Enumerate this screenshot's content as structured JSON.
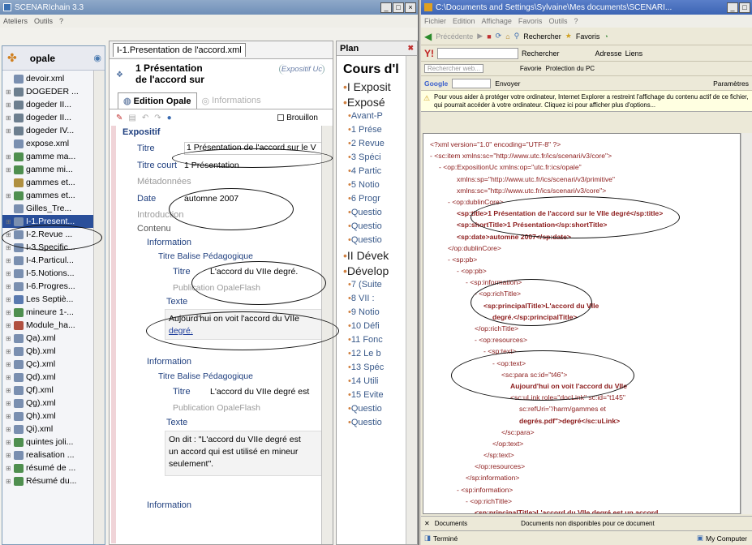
{
  "scenari": {
    "title": "SCENARIchain 3.3",
    "menu": [
      "Ateliers",
      "Outils",
      "?"
    ],
    "workshop": "opale",
    "tree": [
      {
        "label": "devoir.xml",
        "color": "#7a8fb0"
      },
      {
        "label": "DOGEDER ...",
        "color": "#6d7f8f"
      },
      {
        "label": "dogeder II...",
        "color": "#6d7f8f"
      },
      {
        "label": "dogeder II...",
        "color": "#6d7f8f"
      },
      {
        "label": "dogeder IV...",
        "color": "#6d7f8f"
      },
      {
        "label": "expose.xml",
        "color": "#7a8fb0"
      },
      {
        "label": "gamme ma...",
        "color": "#4f8f4f"
      },
      {
        "label": "gamme mi...",
        "color": "#4f8f4f"
      },
      {
        "label": "gammes et...",
        "color": "#b09040"
      },
      {
        "label": "gammes et...",
        "color": "#4f8f4f"
      },
      {
        "label": "Gilles_Tre...",
        "color": "#7a8fb0"
      },
      {
        "label": "I-1.Present...",
        "color": "#7a8fb0",
        "selected": true
      },
      {
        "label": "I-2.Revue ...",
        "color": "#7a8fb0"
      },
      {
        "label": "I-3.Specific...",
        "color": "#7a8fb0"
      },
      {
        "label": "I-4.Particul...",
        "color": "#7a8fb0"
      },
      {
        "label": "I-5.Notions...",
        "color": "#7a8fb0"
      },
      {
        "label": "I-6.Progres...",
        "color": "#7a8fb0"
      },
      {
        "label": "Les Septiè...",
        "color": "#5a7ab0"
      },
      {
        "label": "mineure 1-...",
        "color": "#4f8f4f"
      },
      {
        "label": "Module_ha...",
        "color": "#b05040"
      },
      {
        "label": "Qa).xml",
        "color": "#7a8fb0"
      },
      {
        "label": "Qb).xml",
        "color": "#7a8fb0"
      },
      {
        "label": "Qc).xml",
        "color": "#7a8fb0"
      },
      {
        "label": "Qd).xml",
        "color": "#7a8fb0"
      },
      {
        "label": "Qf).xml",
        "color": "#7a8fb0"
      },
      {
        "label": "Qg).xml",
        "color": "#7a8fb0"
      },
      {
        "label": "Qh).xml",
        "color": "#7a8fb0"
      },
      {
        "label": "Qi).xml",
        "color": "#7a8fb0"
      },
      {
        "label": "quintes joli...",
        "color": "#4f8f4f"
      },
      {
        "label": "realisation ...",
        "color": "#7a8fb0"
      },
      {
        "label": "résumé de ...",
        "color": "#4f8f4f"
      },
      {
        "label": "Résumé du...",
        "color": "#4f8f4f"
      }
    ],
    "editor": {
      "tab_title": "I-1.Presentation de l'accord.xml",
      "doc_title": "1 Présentation de l'accord sur le VIIe",
      "doc_type": "Expositif Uc",
      "tab_edit": "Edition Opale",
      "tab_info": "Informations",
      "brouillon": "Brouillon",
      "section": "Expositif",
      "titre_label": "Titre",
      "titre_value": "1 Présentation de l'accord sur le V",
      "titre_court_label": "Titre court",
      "titre_court_value": "1 Présentation",
      "metadonnees": "Métadonnées",
      "date_label": "Date",
      "date_value": "automne 2007",
      "introduction": "Introduction",
      "contenu": "Contenu",
      "information": "Information",
      "titre_balise": "Titre Balise Pédagogique",
      "titre_short": "Titre",
      "info1_title": "L'accord du VIIe degré.",
      "publication": "Publication OpaleFlash",
      "texte": "Texte",
      "info1_text_a": "Aujourd'hui on voit l'accord du VIIe",
      "info1_text_b": "degré.",
      "info2_title": "L'accord du VIIe degré est",
      "info2_text_1": "On dit : \"L'accord du VIIe degré est",
      "info2_text_2": "un accord qui est utilisé en mineur",
      "info2_text_3": "seulement\"."
    },
    "plan": {
      "header": "Plan",
      "title": "Cours d'l",
      "items": [
        {
          "text": "I Exposit",
          "big": true
        },
        {
          "text": "Exposé",
          "big": true
        },
        {
          "text": "Avant-P"
        },
        {
          "text": "1 Prése"
        },
        {
          "text": "2 Revue"
        },
        {
          "text": "3 Spéci"
        },
        {
          "text": "4 Partic"
        },
        {
          "text": "5 Notio"
        },
        {
          "text": "6 Progr"
        },
        {
          "text": "Questio"
        },
        {
          "text": "Questio"
        },
        {
          "text": "Questio"
        },
        {
          "text": "II Dévek",
          "big": true
        },
        {
          "text": "Dévelop",
          "big": true
        },
        {
          "text": "7 (Suite"
        },
        {
          "text": "8 VII :"
        },
        {
          "text": "9 Notio"
        },
        {
          "text": "10 Défi"
        },
        {
          "text": "11 Fonc"
        },
        {
          "text": "12 Le b"
        },
        {
          "text": "13 Spéc"
        },
        {
          "text": "14 Utili"
        },
        {
          "text": "15 Evite"
        },
        {
          "text": "Questio"
        },
        {
          "text": "Questio"
        }
      ]
    }
  },
  "ie": {
    "title": "C:\\Documents and Settings\\Sylvaine\\Mes documents\\SCENARI...",
    "menu": [
      "Fichier",
      "Edition",
      "Affichage",
      "Favoris",
      "Outils",
      "?"
    ],
    "back": "Précédente",
    "search_btn": "Rechercher",
    "favorites_btn": "Favoris",
    "address_label": "Adresse",
    "links_label": "Liens",
    "yahoo_search": "Rechercher",
    "toolbar3_search": "Rechercher web...",
    "favorie": "Favorie",
    "protection": "Protection du PC",
    "google": "Google",
    "envoyer": "Envoyer",
    "parametres": "Paramètres",
    "infobar": "Pour vous aider à protéger votre ordinateur, Internet Explorer a restreint l'affichage du contenu actif de ce fichier, qui pourrait accéder à votre ordinateur. Cliquez ici pour afficher plus d'options...",
    "xml": [
      {
        "indent": 0,
        "text": "<?xml version=\"1.0\" encoding=\"UTF-8\" ?>"
      },
      {
        "indent": 0,
        "text": "- <sc:item xmlns:sc=\"http://www.utc.fr/ics/scenari/v3/core\">"
      },
      {
        "indent": 1,
        "text": "- <op:ExpositionUc xmlns:op=\"utc.fr:ics/opale\""
      },
      {
        "indent": 3,
        "text": "xmlns:sp=\"http://www.utc.fr/ics/scenari/v3/primitive\""
      },
      {
        "indent": 3,
        "text": "xmlns:sc=\"http://www.utc.fr/ics/scenari/v3/core\">"
      },
      {
        "indent": 2,
        "text": "- <op:dublinCore>"
      },
      {
        "indent": 3,
        "text": "<sp:title>1 Présentation de l'accord sur le VIIe degré</sp:title>"
      },
      {
        "indent": 3,
        "text": "<sp:shortTitle>1 Présentation</sp:shortTitle>"
      },
      {
        "indent": 3,
        "text": "<sp:date>automne 2007</sp:date>"
      },
      {
        "indent": 2,
        "text": "</op:dublinCore>"
      },
      {
        "indent": 2,
        "text": "- <sp:pb>"
      },
      {
        "indent": 3,
        "text": "- <op:pb>"
      },
      {
        "indent": 4,
        "text": "- <sp:information>"
      },
      {
        "indent": 5,
        "text": "- <op:richTitle>"
      },
      {
        "indent": 6,
        "text": "<sp:principalTitle>L'accord du VIIe"
      },
      {
        "indent": 7,
        "text": "degré.</sp:principalTitle>"
      },
      {
        "indent": 5,
        "text": "</op:richTitle>"
      },
      {
        "indent": 5,
        "text": "- <op:resources>"
      },
      {
        "indent": 6,
        "text": "- <sp:text>"
      },
      {
        "indent": 7,
        "text": "- <op:text>"
      },
      {
        "indent": 8,
        "text": "<sc:para sc:id=\"t46\">"
      },
      {
        "indent": 9,
        "text": "Aujourd'hui on voit l'accord du VIIe"
      },
      {
        "indent": 9,
        "text": "<sc:uLink role=\"docLink\" sc:id=\"t145\""
      },
      {
        "indent": 10,
        "text": "sc:refUri=\"/harm/gammes et"
      },
      {
        "indent": 10,
        "text": "degrés.pdf\">degré</sc:uLink>"
      },
      {
        "indent": 8,
        "text": "</sc:para>"
      },
      {
        "indent": 7,
        "text": "</op:text>"
      },
      {
        "indent": 6,
        "text": "</sp:text>"
      },
      {
        "indent": 5,
        "text": "</op:resources>"
      },
      {
        "indent": 4,
        "text": "</sp:information>"
      },
      {
        "indent": 3,
        "text": "- <sp:information>"
      },
      {
        "indent": 4,
        "text": "- <op:richTitle>"
      },
      {
        "indent": 5,
        "text": "<sp:principalTitle>L'accord du VIIe degré est un accord"
      },
      {
        "indent": 6,
        "text": "qui est utilisé en mineur"
      }
    ],
    "taskbar_docs": "Documents",
    "taskbar_note": "Documents non disponibles pour ce document",
    "status_left": "Terminé",
    "status_right": "My Computer"
  }
}
